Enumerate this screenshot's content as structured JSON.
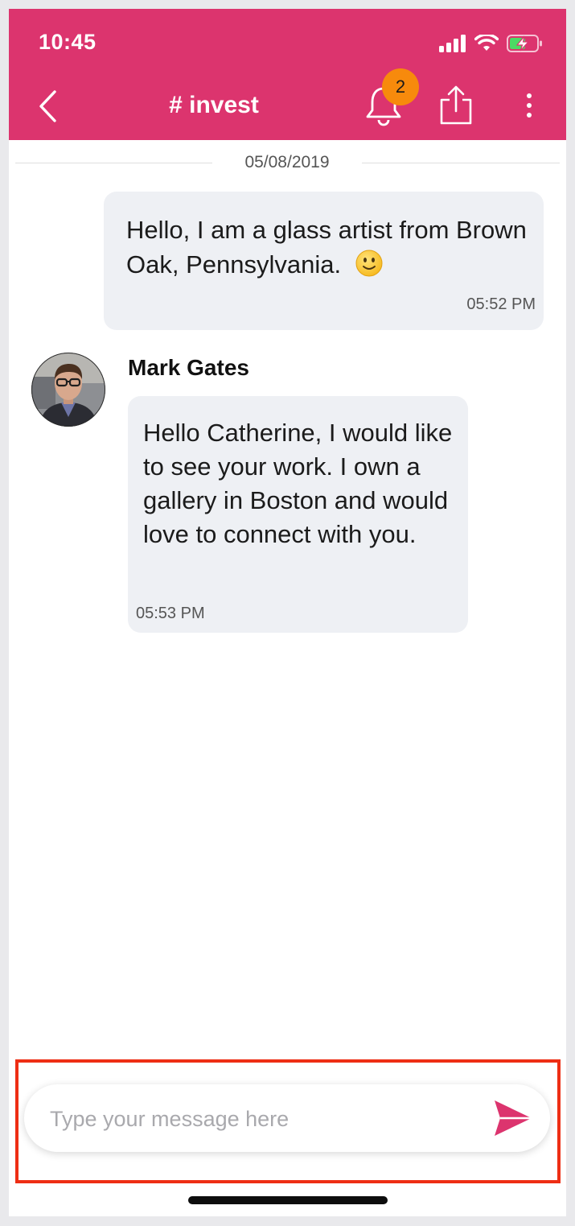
{
  "status_bar": {
    "time": "10:45",
    "icons": [
      "cellular-signal-icon",
      "wifi-icon",
      "battery-charging-icon"
    ]
  },
  "header": {
    "back_icon": "chevron-left-icon",
    "channel_name": "# invest",
    "notification_count": "2",
    "notification_icon": "bell-icon",
    "share_icon": "share-icon",
    "more_icon": "more-vertical-icon"
  },
  "conversation": {
    "date_separator": "05/08/2019",
    "messages": [
      {
        "direction": "outgoing",
        "text": "Hello, I am a glass artist from Brown Oak, Pennsylvania.",
        "emoji": "slightly-smiling-face-icon",
        "time": "05:52 PM"
      },
      {
        "direction": "incoming",
        "sender": "Mark Gates",
        "text": "Hello Catherine, I would like to see your work. I own a gallery in Boston and would love to connect with you.",
        "time": "05:53 PM"
      }
    ]
  },
  "composer": {
    "placeholder": "Type your message here",
    "value": "",
    "send_icon": "send-icon"
  },
  "colors": {
    "header_background": "#dc346e",
    "badge": "#f78a0c",
    "bubble": "#eef0f4",
    "highlight_border": "#ee2e14",
    "send_icon": "#dc346e"
  }
}
